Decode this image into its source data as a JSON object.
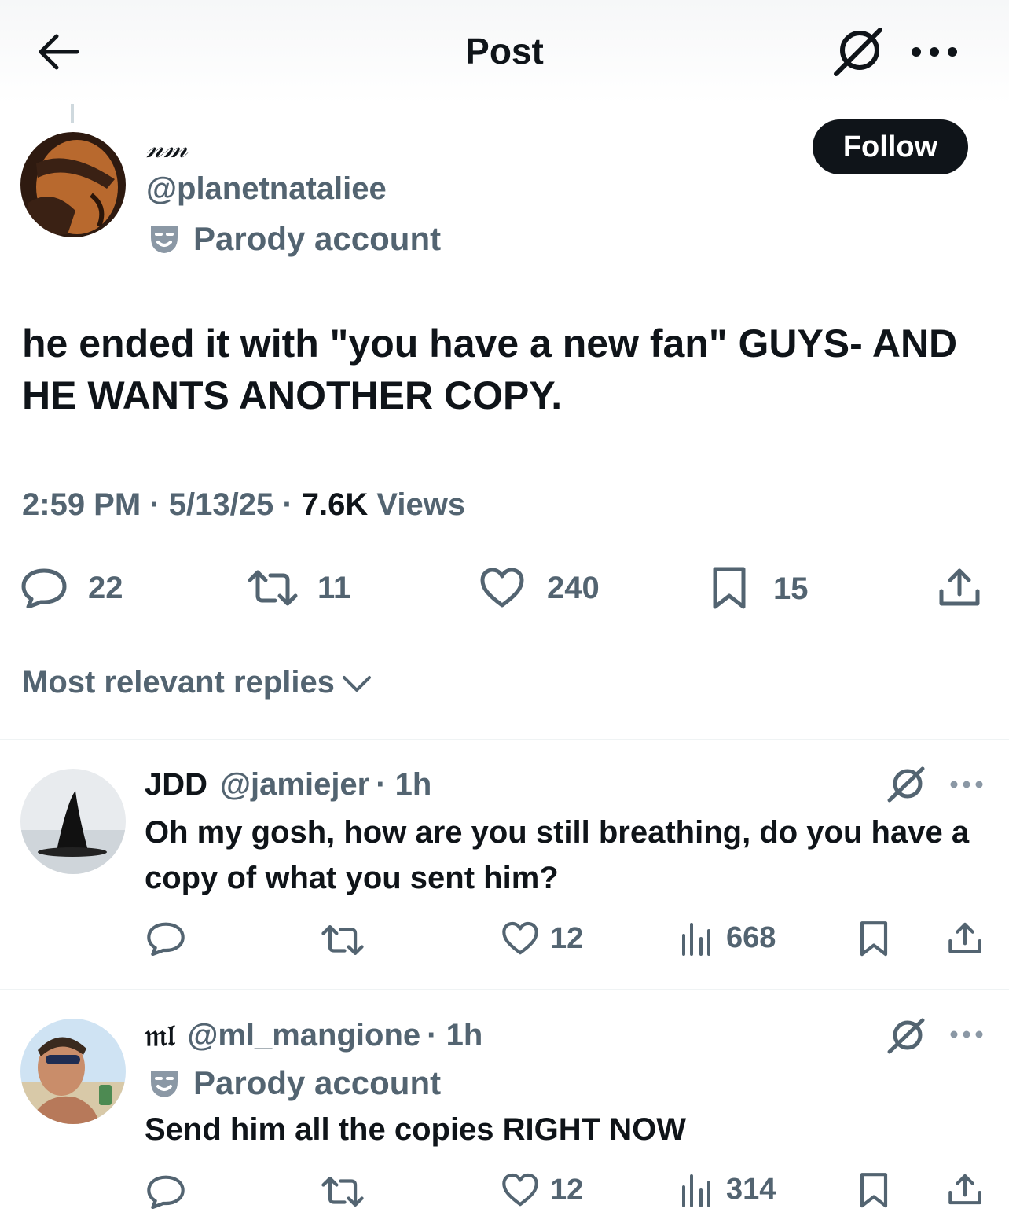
{
  "header": {
    "title": "Post",
    "back_icon": "arrow-left-icon",
    "grok_icon": "grok-icon",
    "more_icon": "more-horizontal-icon"
  },
  "post": {
    "display_name": "𝓃𝓂",
    "handle": "@planetnataliee",
    "label": "Parody account",
    "follow_label": "Follow",
    "text": "he ended it with \"you have a new fan\" GUYS- AND HE WANTS ANOTHER COPY.",
    "time": "2:59 PM",
    "date": "5/13/25",
    "separator": "·",
    "views_count": "7.6K",
    "views_label": "Views",
    "replies": "22",
    "reposts": "11",
    "likes": "240",
    "bookmarks": "15"
  },
  "replies_sort": {
    "label": "Most relevant replies"
  },
  "replies": [
    {
      "name": "JDD",
      "handle": "@jamiejer",
      "time": "· 1h",
      "text": "Oh my gosh, how are you still breathing, do you have a copy of what you sent him?",
      "likes": "12",
      "views": "668"
    },
    {
      "name": "𝔪𝔩",
      "handle": "@ml_mangione",
      "time": "· 1h",
      "label": "Parody account",
      "text": "Send him all the copies RIGHT NOW",
      "likes": "12",
      "views": "314"
    }
  ],
  "colors": {
    "text_primary": "#0f1419",
    "text_secondary": "#536471",
    "follow_bg": "#0f1419",
    "divider": "#eff3f4"
  }
}
